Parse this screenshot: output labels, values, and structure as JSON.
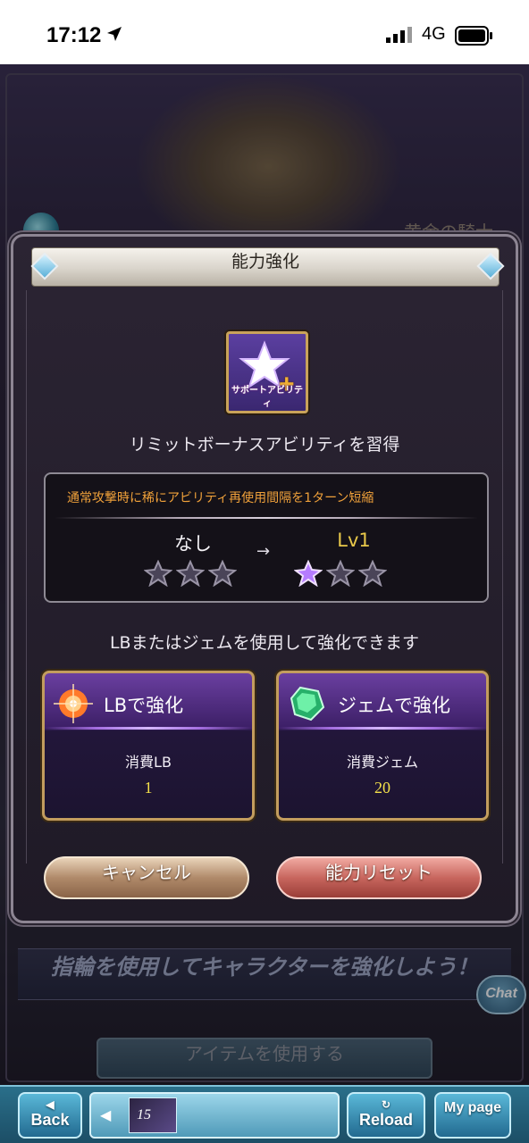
{
  "status_bar": {
    "time": "17:12",
    "network": "4G",
    "icons": [
      "location-arrow-icon",
      "signal-bars-icon",
      "battery-icon"
    ]
  },
  "background": {
    "character_name": "黄金の騎士",
    "banner_text": "指輪を使用してキャラクターを強化しよう！",
    "use_item_button": "アイテムを使用する",
    "chat_label": "Chat"
  },
  "dialog": {
    "title": "能力強化",
    "ability_icon_caption": "サポートアビリティ",
    "learn_text": "リミットボーナスアビリティを習得",
    "description": "通常攻撃時に稀にアビリティ再使用間隔を1ターン短縮",
    "level_from": "なし",
    "level_to": "Lv1",
    "arrow": "→",
    "stars_from_filled": 0,
    "stars_to_filled": 1,
    "stars_total": 3,
    "enhance_text": "LBまたはジェムを使用して強化できます",
    "option_lb": {
      "label": "LBで強化",
      "cost_label": "消費LB",
      "cost_value": "1"
    },
    "option_gem": {
      "label": "ジェムで強化",
      "cost_label": "消費ジェム",
      "cost_value": "20"
    },
    "cancel_button": "キャンセル",
    "reset_button": "能力リセット"
  },
  "nav": {
    "back_label": "Back",
    "banner_level": "15",
    "reload_label": "Reload",
    "mypage_label": "My page"
  },
  "colors": {
    "description_text": "#f0a13a",
    "level_to_text": "#e8c84a",
    "cost_value_text": "#f4e04a"
  }
}
